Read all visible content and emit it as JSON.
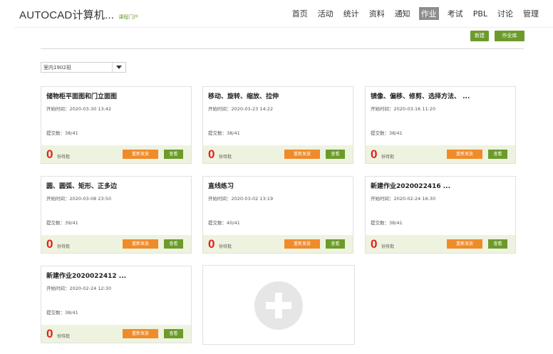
{
  "header": {
    "title": "AUTOCAD计算机...",
    "subtitle": "课程门户",
    "nav": [
      {
        "label": "首页",
        "active": false
      },
      {
        "label": "活动",
        "active": false
      },
      {
        "label": "统计",
        "active": false
      },
      {
        "label": "资料",
        "active": false
      },
      {
        "label": "通知",
        "active": false
      },
      {
        "label": "作业",
        "active": true
      },
      {
        "label": "考试",
        "active": false
      },
      {
        "label": "PBL",
        "active": false
      },
      {
        "label": "讨论",
        "active": false
      },
      {
        "label": "管理",
        "active": false
      }
    ]
  },
  "actions": {
    "new_label": "新建",
    "library_label": "作业库"
  },
  "class_select": {
    "value": "室内1902班"
  },
  "card_labels": {
    "start_prefix": "开始时间：",
    "submit_prefix": "提交数：",
    "pending_label": "份待批",
    "resend_label": "重新发放",
    "view_label": "查看"
  },
  "assignments": [
    {
      "title": "储物柜平面图和门立面图",
      "start_time": "2020-03-30 13:42",
      "submitted": "38/41",
      "pending": "0"
    },
    {
      "title": "移动、旋转、缩放、拉伸",
      "start_time": "2020-03-23 14:22",
      "submitted": "38/41",
      "pending": "0"
    },
    {
      "title": "镜像、偏移、修剪、选择方法、 ...",
      "start_time": "2020-03-16 11:20",
      "submitted": "38/41",
      "pending": "0"
    },
    {
      "title": "圆、圆弧、矩形、正多边",
      "start_time": "2020-03-08 23:50",
      "submitted": "39/41",
      "pending": "0"
    },
    {
      "title": "直线练习",
      "start_time": "2020-03-02 13:19",
      "submitted": "40/41",
      "pending": "0"
    },
    {
      "title": "新建作业2020022416 ...",
      "start_time": "2020-02-24 16:30",
      "submitted": "38/41",
      "pending": "0"
    },
    {
      "title": "新建作业2020022412 ...",
      "start_time": "2020-02-24 12:30",
      "submitted": "38/41",
      "pending": "0"
    }
  ],
  "add_card": {
    "icon": "plus-icon"
  },
  "colors": {
    "green": "#6d9b2b",
    "orange": "#f08b2a",
    "red": "#e02020",
    "footer_bg": "#eef3df",
    "active_nav": "#8d8d8d"
  }
}
